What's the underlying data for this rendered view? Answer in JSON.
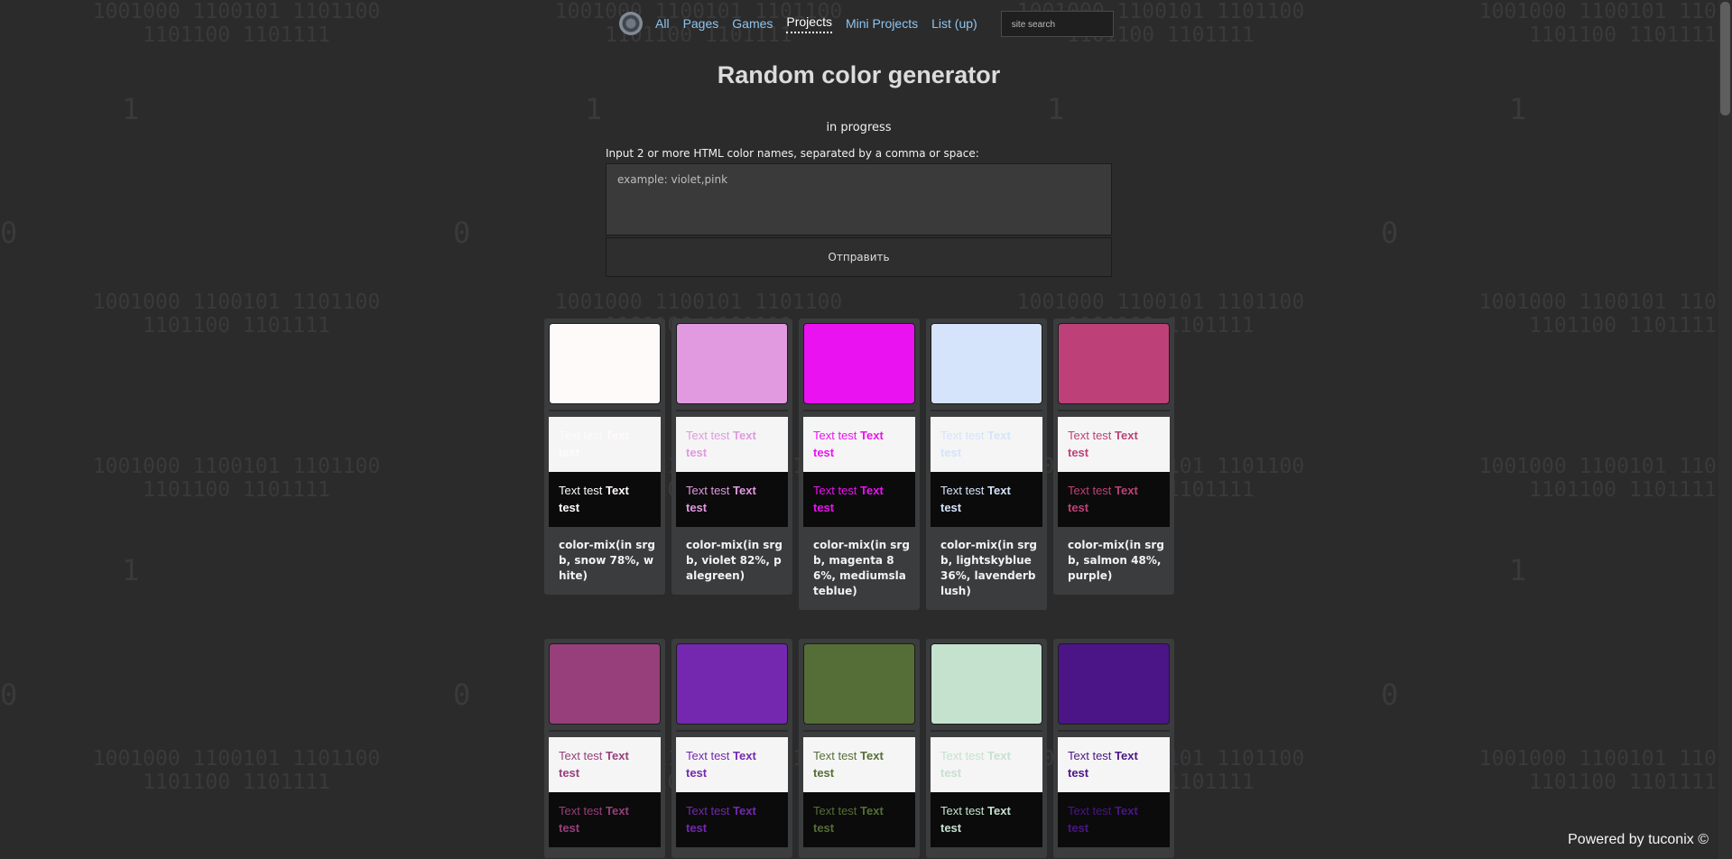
{
  "nav": {
    "items": [
      {
        "label": "All"
      },
      {
        "label": "Pages"
      },
      {
        "label": "Games"
      },
      {
        "label": "Projects",
        "active": true
      },
      {
        "label": "Mini Projects"
      },
      {
        "label": "List (up)"
      }
    ],
    "search_placeholder": "site search"
  },
  "title": "Random color generator",
  "status": "in progress",
  "prompt": "Input 2 or more HTML color names, separated by a comma or space:",
  "input": {
    "placeholder": "example: violet,pink",
    "value": ""
  },
  "submit_label": "Отправить",
  "sample_text": {
    "normal": "Text test",
    "bold": "Text test"
  },
  "cards": [
    {
      "color": "#fffafa",
      "mix": "color-mix(in srgb, snow 78%, white)"
    },
    {
      "color": "#e199e0",
      "mix": "color-mix(in srgb, violet 82%, palegreen)"
    },
    {
      "color": "#eb12f2",
      "mix": "color-mix(in srgb, magenta 86%, mediumslateblue)"
    },
    {
      "color": "#d5e4fb",
      "mix": "color-mix(in srgb, lightskyblue 36%, lavenderblush)"
    },
    {
      "color": "#bd4178",
      "mix": "color-mix(in srgb, salmon 48%, purple)"
    },
    {
      "color": "#973f7b",
      "mix": ""
    },
    {
      "color": "#7428b0",
      "mix": ""
    },
    {
      "color": "#556e37",
      "mix": ""
    },
    {
      "color": "#c5e2cf",
      "mix": ""
    },
    {
      "color": "#4b1587",
      "mix": ""
    }
  ],
  "background": {
    "binary_lines": [
      [
        "1001000 1100101 1101100",
        "1101100 1101111"
      ],
      [
        "1001000 1100101 1101100",
        "1101100 1101111"
      ]
    ],
    "digits": [
      "1",
      "0"
    ]
  },
  "footer": "Powered by tuconix ©",
  "colors": {
    "page_bg": "#2b2b2c",
    "nav_link": "#8fc5ee",
    "card_bg": "#3b3c3d"
  }
}
